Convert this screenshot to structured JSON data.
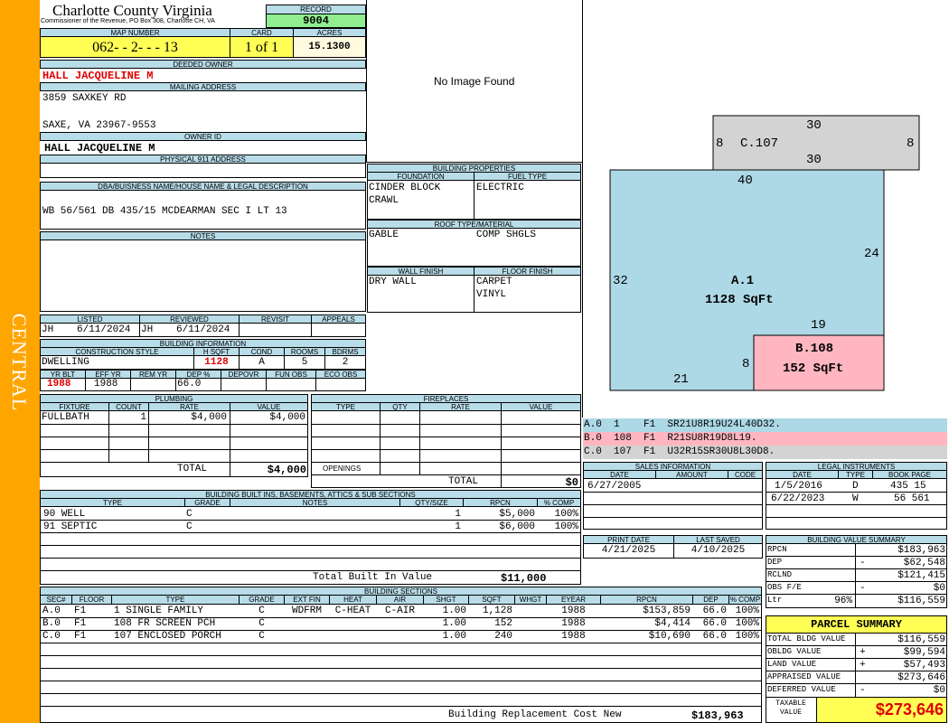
{
  "side_label": "CENTRAL",
  "header": {
    "county": "Charlotte County Virginia",
    "commissioner": "Commissioner of the Revenue, PO Box 308, Charlotte CH, VA",
    "record_label": "RECORD",
    "record": "9004",
    "map_number_label": "MAP NUMBER",
    "map_number": "062- - 2- - - 13",
    "card_label": "CARD",
    "card": "1 of 1",
    "acres_label": "ACRES",
    "acres": "15.1300"
  },
  "owner": {
    "deeded_owner_label": "DEEDED OWNER",
    "deeded_owner": "HALL JACQUELINE M",
    "mailing_address_label": "MAILING ADDRESS",
    "address1": "3859 SAXKEY RD",
    "address2": "SAXE, VA 23967-9553",
    "owner_id_label": "OWNER ID",
    "owner_id": "HALL JACQUELINE M",
    "physical_address_label": "PHYSICAL 911 ADDRESS"
  },
  "legal": {
    "label": "DBA/BUISNESS NAME/HOUSE NAME & LEGAL DESCRIPTION",
    "text": "WB 56/561 DB 435/15 MCDEARMAN SEC I LT 13"
  },
  "notes_label": "NOTES",
  "image_placeholder": "No Image Found",
  "building_properties": {
    "label": "BUILDING PROPERTIES",
    "foundation_label": "FOUNDATION",
    "foundation": [
      "CINDER BLOCK",
      "CRAWL"
    ],
    "fuel_label": "FUEL TYPE",
    "fuel": "ELECTRIC",
    "roof_label": "ROOF TYPE/MATERIAL",
    "roof_type": "GABLE",
    "roof_material": "COMP SHGLS",
    "wall_label": "WALL FINISH",
    "wall": "DRY WALL",
    "floor_label": "FLOOR FINISH",
    "floor": [
      "CARPET",
      "VINYL"
    ]
  },
  "listing": {
    "listed_label": "LISTED",
    "reviewed_label": "REVIEWED",
    "revisit_label": "REVISIT",
    "appeals_label": "APPEALS",
    "listed_by": "JH",
    "listed_date": "6/11/2024",
    "reviewed_by": "JH",
    "reviewed_date": "6/11/2024"
  },
  "building_info": {
    "label": "BUILDING INFORMATION",
    "style_label": "CONSTRUCTION STYLE",
    "hsqft_label": "H SQFT",
    "cond_label": "COND",
    "rooms_label": "ROOMS",
    "bdrms_label": "BDRMS",
    "style": "DWELLING",
    "hsqft": "1128",
    "cond": "A",
    "rooms": "5",
    "bdrms": "2",
    "yrblt_label": "YR BLT",
    "effyr_label": "EFF YR",
    "remyr_label": "REM YR",
    "dep_label": "DEP %",
    "depovr_label": "DEPOVR",
    "funobs_label": "FUN OBS",
    "ecoobs_label": "ECO OBS",
    "yrblt": "1988",
    "effyr": "1988",
    "dep": "66.0"
  },
  "plumbing": {
    "label": "PLUMBING",
    "cols": [
      "FIXTURE",
      "COUNT",
      "RATE",
      "VALUE"
    ],
    "rows": [
      [
        "FULLBATH",
        "1",
        "$4,000",
        "$4,000"
      ]
    ],
    "total_label": "TOTAL",
    "total": "$4,000"
  },
  "fireplaces": {
    "label": "FIREPLACES",
    "cols": [
      "TYPE",
      "QTY",
      "RATE",
      "VALUE"
    ],
    "openings_label": "OPENINGS",
    "total_label": "TOTAL",
    "total": "$0"
  },
  "built_ins": {
    "label": "BUILDING BUILT INS, BASEMENTS, ATTICS & SUB SECTIONS",
    "cols": [
      "TYPE",
      "GRADE",
      "NOTES",
      "QTY/SIZE",
      "RPCN",
      "% COMP"
    ],
    "rows": [
      [
        "90 WELL",
        "C",
        "",
        "1",
        "$5,000",
        "100%"
      ],
      [
        "91 SEPTIC",
        "C",
        "",
        "1",
        "$6,000",
        "100%"
      ]
    ],
    "total_label": "Total Built In Value",
    "total": "$11,000"
  },
  "sketch": {
    "sections": [
      {
        "name": "A.1",
        "area": "1128 SqFt",
        "color": "#add8e6"
      },
      {
        "name": "B.108",
        "area": "152 SqFt",
        "color": "#ffb6c1"
      },
      {
        "name": "C.107",
        "area": "",
        "color": "#d3d3d3"
      }
    ],
    "dims": {
      "c_top": "30",
      "c_bottom": "30",
      "c_left": "8",
      "c_right": "8",
      "a_top": "40",
      "a_right": "24",
      "a_left": "32",
      "a_bottom": "21",
      "b_top": "19",
      "b_left": "8"
    },
    "legend": [
      {
        "text": "A.0  1    F1  SR21U8R19U24L40D32.",
        "color": "#add8e6"
      },
      {
        "text": "B.0  108  F1  R21SU8R19D8L19.",
        "color": "#ffb6c1"
      },
      {
        "text": "C.0  107  F1  U32R15SR30U8L30D8.",
        "color": "#d3d3d3"
      }
    ]
  },
  "sales": {
    "label": "SALES INFORMATION",
    "cols": [
      "DATE",
      "AMOUNT",
      "CODE"
    ],
    "rows": [
      [
        "6/27/2005",
        "",
        ""
      ]
    ]
  },
  "legal_instruments": {
    "label": "LEGAL INSTRUMENTS",
    "cols": [
      "DATE",
      "TYPE",
      "BOOK PAGE"
    ],
    "rows": [
      [
        "1/5/2016",
        "D",
        "435 15"
      ],
      [
        "6/22/2023",
        "W",
        "56 561"
      ]
    ]
  },
  "print_info": {
    "print_label": "PRINT DATE",
    "print_date": "4/21/2025",
    "saved_label": "LAST SAVED",
    "saved_date": "4/10/2025"
  },
  "value_summary": {
    "label": "BUILDING VALUE SUMMARY",
    "rows": [
      {
        "label": "RPCN",
        "sign": "",
        "value": "$183,963"
      },
      {
        "label": "DEP",
        "sign": "-",
        "value": "$62,548"
      },
      {
        "label": "RCLND",
        "sign": "",
        "value": "$121,415"
      },
      {
        "label": "OBS F/E",
        "sign": "-",
        "value": "$0"
      },
      {
        "label": "Ltr",
        "pct": "96%",
        "sign": "",
        "value": "$116,559"
      }
    ]
  },
  "parcel_summary": {
    "label": "PARCEL SUMMARY",
    "rows": [
      {
        "label": "TOTAL BLDG VALUE",
        "sign": "",
        "value": "$116,559"
      },
      {
        "label": "OBLDG VALUE",
        "sign": "+",
        "value": "$99,594"
      },
      {
        "label": "LAND VALUE",
        "sign": "+",
        "value": "$57,493"
      },
      {
        "label": "APPRAISED VALUE",
        "sign": "",
        "value": "$273,646"
      },
      {
        "label": "DEFERRED VALUE",
        "sign": "-",
        "value": "$0"
      }
    ],
    "taxable_label": "TAXABLE VALUE",
    "taxable": "$273,646"
  },
  "building_sections": {
    "label": "BUILDING SECTIONS",
    "cols": [
      "SEC#",
      "FLOOR",
      "TYPE",
      "GRADE",
      "EXT FIN",
      "HEAT",
      "AIR",
      "SHGT",
      "SQFT",
      "WHGT",
      "EYEAR",
      "RPCN",
      "DEP",
      "% COMP"
    ],
    "rows": [
      [
        "A.0",
        "F1",
        "1 SINGLE FAMILY",
        "C",
        "WDFRM",
        "C-HEAT",
        "C-AIR",
        "1.00",
        "1,128",
        "",
        "1988",
        "$153,859",
        "66.0",
        "100%"
      ],
      [
        "B.0",
        "F1",
        "108 FR SCREEN PCH",
        "C",
        "",
        "",
        "",
        "1.00",
        "152",
        "",
        "1988",
        "$4,414",
        "66.0",
        "100%"
      ],
      [
        "C.0",
        "F1",
        "107 ENCLOSED PORCH",
        "C",
        "",
        "",
        "",
        "1.00",
        "240",
        "",
        "1988",
        "$10,690",
        "66.0",
        "100%"
      ]
    ],
    "rcn_label": "Building Replacement Cost New",
    "rcn": "$183,963"
  }
}
